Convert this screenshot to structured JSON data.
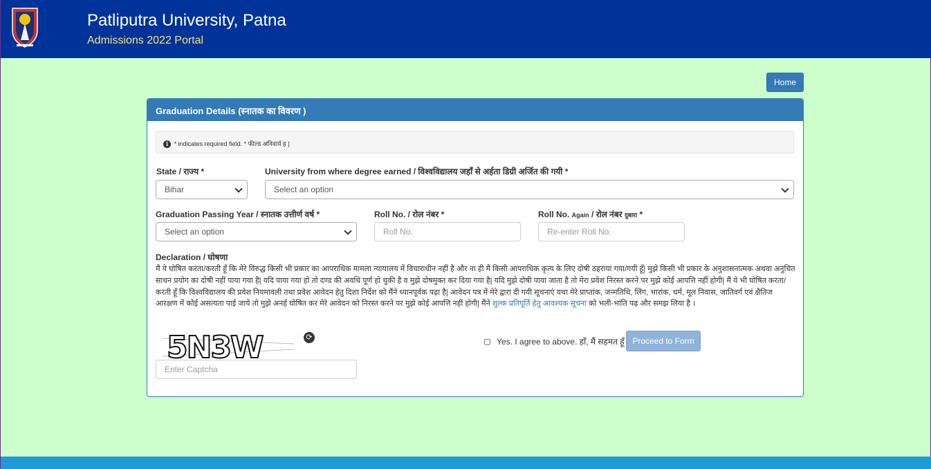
{
  "header": {
    "title": "Patliputra University, Patna",
    "subtitle": "Admissions 2022 Portal"
  },
  "nav": {
    "home_label": "Home"
  },
  "panel": {
    "title": "Graduation Details (स्नातक का विवरण )",
    "info_text": "* indicates required field. * फील्ड अनिवार्य ह |"
  },
  "form": {
    "state": {
      "label": "State / राज्य *",
      "value": "Bihar"
    },
    "university": {
      "label": "University from where degree earned / विश्वविद्यालय जहाँ से अर्हता डिग्री अर्जित की गयी *",
      "value": "Select an option"
    },
    "passing_year": {
      "label": "Graduation Passing Year / स्नातक उत्तीर्ण वर्ष *",
      "value": "Select an option"
    },
    "roll_no": {
      "label": "Roll No. / रोल नंबर *",
      "placeholder": "Roll No."
    },
    "roll_no_again": {
      "label_a": "Roll No. ",
      "label_small": "Again",
      "label_b": " / रोल नंबर ",
      "label_small2": "दुबारा",
      "label_c": " *",
      "placeholder": "Re-enter Roll No."
    }
  },
  "declaration": {
    "title": "Declaration / घोषणा",
    "text": "मैं ये घोषित करता/करती हूँ कि मेरे विरुद्ध किसी भी प्रकार का आपराधिक मामला न्यायालय में विचाराधीन नहीं है और ना ही मैं किसी आपराधिक कृत्य के लिए दोषी ठहराया गया/गयी हूँ| मुझे किसी भी प्रकार के अनुशासनात्मक अथवा अनुचित साधन प्रयोग का दोषी नहीं पाया गया है| यदि पाया गया हो तो दण्ड की अवधि पूर्ण हो चुकी है व मुझे दोषमुक्त कर दिया गया है| यदि मुझे दोषी पाया जाता है तो मेरा प्रवेश निरस्त करने पर मुझे कोई आपत्ति नहीं होगी| मैं ये भी घोषित करता/करती हूँ कि विश्वविद्यालय की प्रवेश नियमावली तथा प्रवेश आवेदन हेतु दिशा निर्देश को मैंने ध्यानपूर्वक पढ़ा है| आवेदन पत्र में मेरे द्वारा दी गयी सूचनाएं यथा मेरे प्राप्तांक, जन्मतिथि, लिंग, भारांक, धर्म, मूल निवास, जातिवर्ग एवं क्षैतिज आरक्षण में कोई असत्यता पाई जाये तो मुझे अनर्ह घोषित कर मेरे आवेदन को निरस्त करने पर मुझे कोई आपत्ति नहीं होगी| मैंने",
    "link_text": "शुल्क प्रतिपूर्ति हेतु आवश्यक सूचना",
    "text_end": "को भली-भांति पढ़ और समझ लिया है ।"
  },
  "captcha": {
    "code": "5N3W",
    "placeholder": "Enter Captcha"
  },
  "agree": {
    "label": "Yes. I agree to above. हाँ, मैं सहमत हूँ",
    "proceed_label": "Proceed to Form"
  },
  "colors": {
    "header_bg": "#00339a",
    "page_bg": "#ccffcc",
    "primary": "#337ab7",
    "subtitle": "#f3e57a",
    "footer": "#1f9ad6"
  }
}
